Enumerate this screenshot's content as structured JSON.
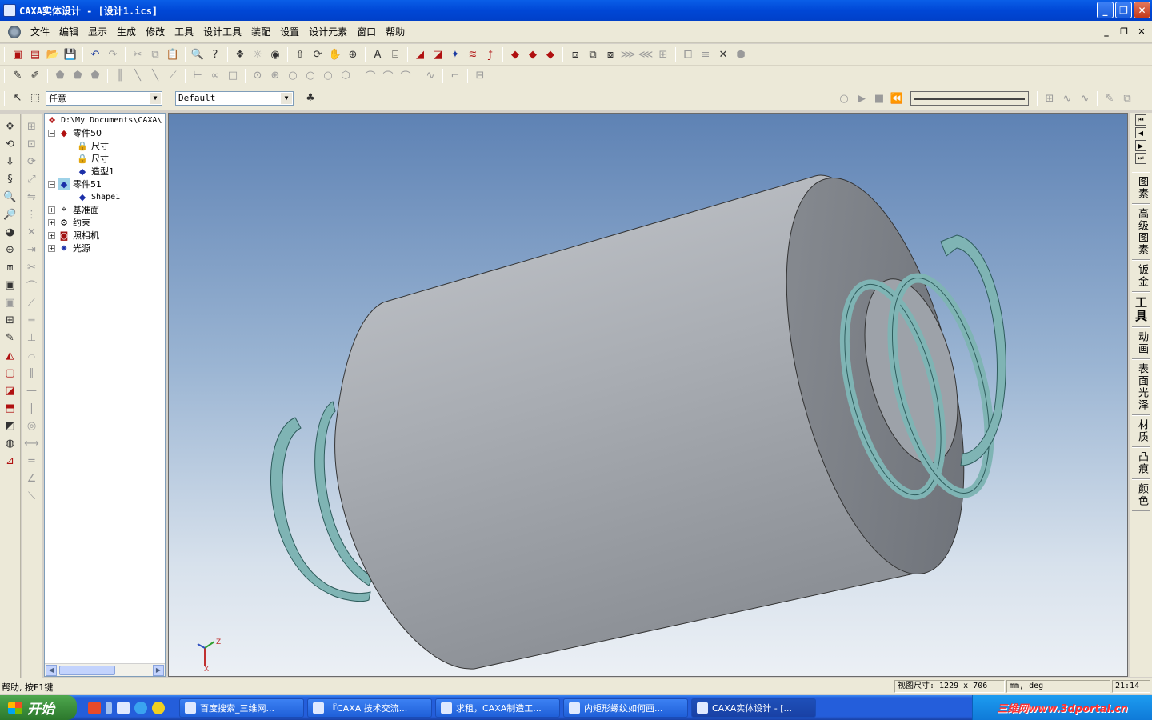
{
  "window": {
    "title": "CAXA实体设计 - [设计1.ics]",
    "buttons": [
      "_",
      "❐",
      "✕"
    ]
  },
  "menu": [
    "文件",
    "编辑",
    "显示",
    "生成",
    "修改",
    "工具",
    "设计工具",
    "装配",
    "设置",
    "设计元素",
    "窗口",
    "帮助"
  ],
  "mdi_buttons": [
    "_",
    "❐",
    "✕"
  ],
  "toolbar3": {
    "filter_value": "任意",
    "style_value": "Default"
  },
  "tree": {
    "root": "D:\\My Documents\\CAXA\\",
    "part50": "零件50",
    "dim1": "尺寸",
    "dim2": "尺寸",
    "shape_model": "造型1",
    "part51": "零件51",
    "shape1": "Shape1",
    "datum": "基准面",
    "constraint": "约束",
    "camera": "照相机",
    "light": "光源"
  },
  "axes": {
    "z": "Z",
    "x": "X"
  },
  "right_tabs": [
    "图素",
    "高级图素",
    "钣金",
    "工具",
    "动画",
    "表面光泽",
    "材质",
    "凸痕",
    "颜色"
  ],
  "right_active": "工具",
  "status": {
    "help": "帮助, 按F1键",
    "view_size": "视图尺寸: 1229 x  706",
    "units": "mm, deg",
    "time": "21:14"
  },
  "taskbar": {
    "start": "开始",
    "tasks": [
      "百度搜索_三维网...",
      "『CAXA 技术交流...",
      "求租，CAXA制造工...",
      "内矩形螺纹如何画...",
      "CAXA实体设计 - [..."
    ],
    "watermark": "三维网www.3dportal.cn"
  },
  "colors": {
    "titlebar": "#0a5fe8",
    "viewport_top": "#5e82b4",
    "viewport_bottom": "#ecf0f5",
    "cylinder": "#a9adb2",
    "spring": "#7fb4b4"
  }
}
